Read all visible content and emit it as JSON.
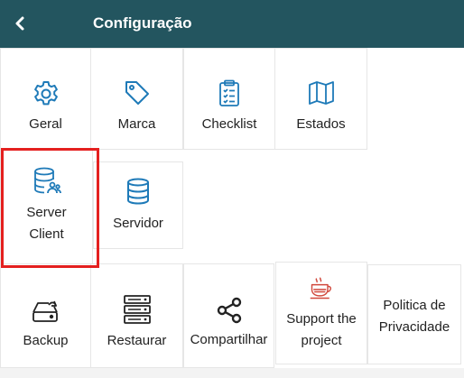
{
  "header": {
    "title": "Configuração"
  },
  "tiles": {
    "geral": {
      "label": "Geral",
      "icon": "gear-icon"
    },
    "marca": {
      "label": "Marca",
      "icon": "tag-icon"
    },
    "checklist": {
      "label": "Checklist",
      "icon": "clipboard-checklist-icon"
    },
    "estados": {
      "label": "Estados",
      "icon": "map-icon"
    },
    "server_client": {
      "label": "Server Client",
      "icon": "database-users-icon"
    },
    "servidor": {
      "label": "Servidor",
      "icon": "database-icon"
    },
    "backup": {
      "label": "Backup",
      "icon": "hard-drive-backup-icon"
    },
    "restaurar": {
      "label": "Restaurar",
      "icon": "server-rack-icon"
    },
    "compartilhar": {
      "label": "Compartilhar",
      "icon": "share-icon"
    },
    "support": {
      "label": "Support the project",
      "icon": "coffee-cup-icon"
    },
    "privacidade": {
      "label": "Politica de Privacidade"
    }
  },
  "colors": {
    "header_bg": "#23555f",
    "icon_blue": "#1e7ab8",
    "highlight": "#e4201f",
    "coffee": "#d1483c"
  }
}
